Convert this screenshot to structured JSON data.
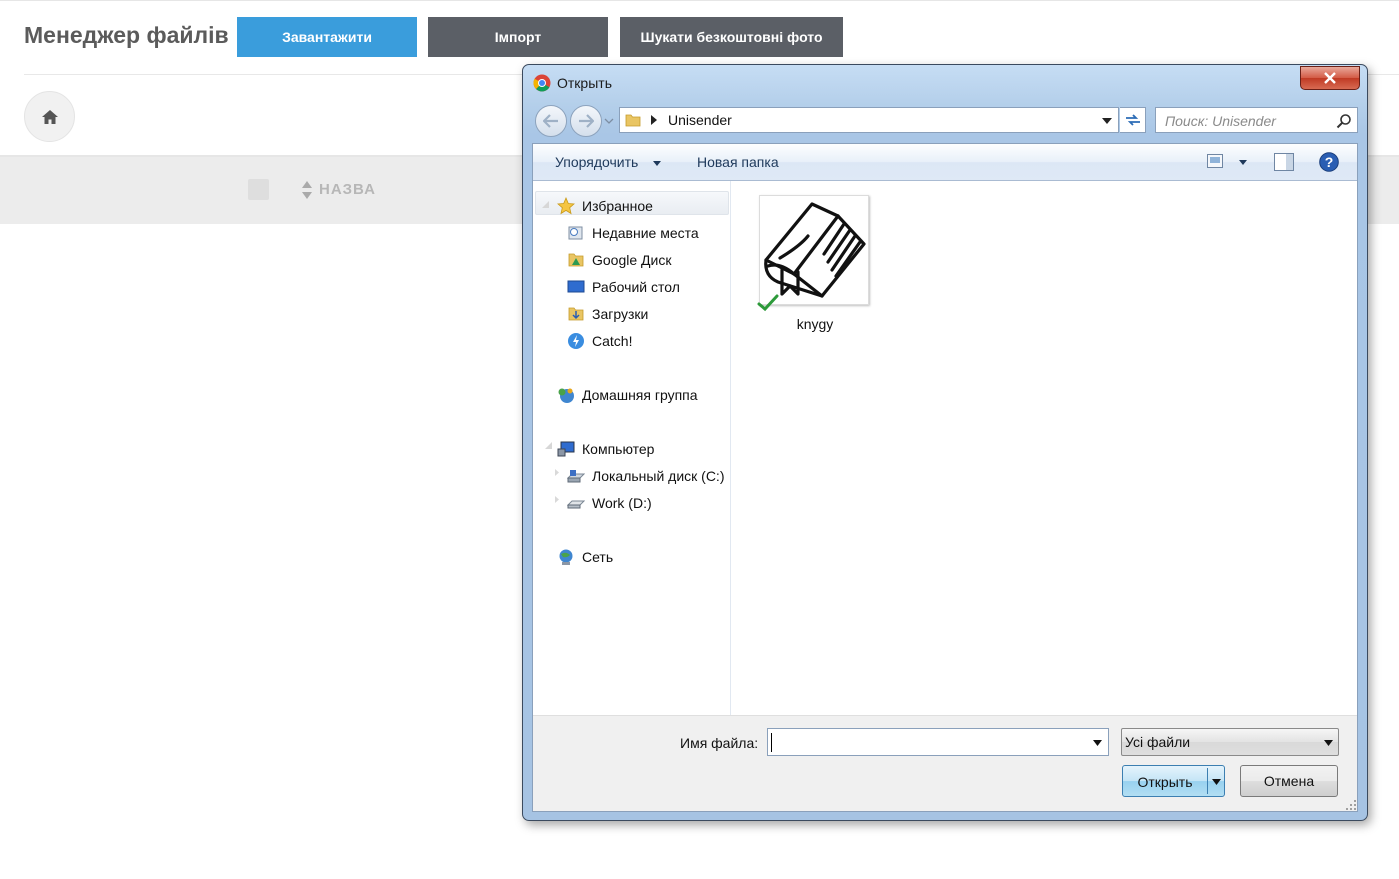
{
  "page": {
    "title": "Менеджер файлів",
    "buttons": {
      "upload": "Завантажити",
      "import": "Імпорт",
      "free_photos": "Шукати безкоштовні фото"
    },
    "table": {
      "name_header": "НАЗВА"
    },
    "colors": {
      "upload_bg": "#3a9ddc",
      "secondary_bg": "#5b5f66"
    }
  },
  "dialog": {
    "title": "Открыть",
    "address": {
      "current": "Unisender"
    },
    "search": {
      "placeholder": "Поиск: Unisender"
    },
    "commands": {
      "organize": "Упорядочить",
      "new_folder": "Новая папка"
    },
    "nav": {
      "favorites": "Избранное",
      "favorites_items": [
        "Недавние места",
        "Google Диск",
        "Рабочий стол",
        "Загрузки",
        "Catch!"
      ],
      "homegroup": "Домашняя группа",
      "computer": "Компьютер",
      "computer_items": [
        "Локальный диск (C:)",
        "Work (D:)"
      ],
      "network": "Сеть"
    },
    "files": [
      {
        "name": "knygy",
        "icon": "book-icon",
        "synced": true
      }
    ],
    "footer": {
      "filename_label": "Имя файла:",
      "filename_value": "",
      "filetype": "Усі файли",
      "open_label": "Открыть",
      "cancel_label": "Отмена"
    }
  }
}
